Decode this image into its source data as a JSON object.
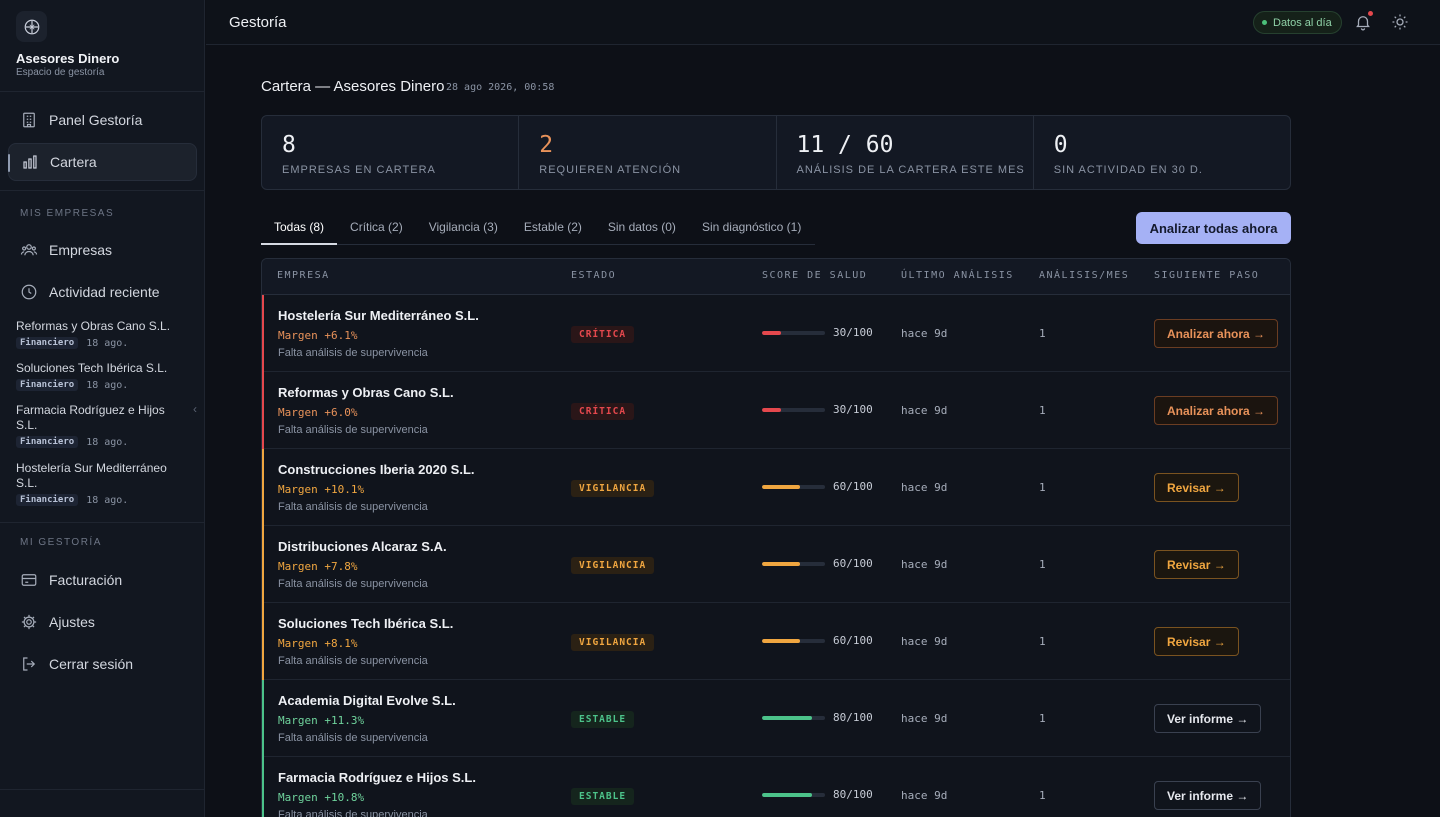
{
  "sidebar": {
    "brand": {
      "name": "Asesores Dinero",
      "subtitle": "Espacio de gestoría"
    },
    "nav_main": [
      {
        "label": "Panel Gestoría",
        "icon": "building-icon",
        "active": false
      },
      {
        "label": "Cartera",
        "icon": "bar-chart-icon",
        "active": true
      }
    ],
    "section_companies": "MIS EMPRESAS",
    "nav_companies": [
      {
        "label": "Empresas",
        "icon": "users-icon"
      },
      {
        "label": "Actividad reciente",
        "icon": "clock-icon"
      }
    ],
    "recent": [
      {
        "name": "Reformas y Obras Cano S.L.",
        "tag": "Financiero",
        "date": "18 ago."
      },
      {
        "name": "Soluciones Tech Ibérica S.L.",
        "tag": "Financiero",
        "date": "18 ago."
      },
      {
        "name": "Farmacia Rodríguez e Hijos S.L.",
        "tag": "Financiero",
        "date": "18 ago."
      },
      {
        "name": "Hostelería Sur Mediterráneo S.L.",
        "tag": "Financiero",
        "date": "18 ago."
      }
    ],
    "section_gestoria": "MI GESTORÍA",
    "nav_gestoria": [
      {
        "label": "Facturación",
        "icon": "credit-card-icon"
      },
      {
        "label": "Ajustes",
        "icon": "gear-icon"
      },
      {
        "label": "Cerrar sesión",
        "icon": "logout-icon"
      }
    ]
  },
  "topbar": {
    "title": "Gestoría",
    "status": "Datos al día"
  },
  "main": {
    "heading": "Cartera — Asesores Dinero",
    "timestamp": "28 ago 2026, 00:58",
    "stats": [
      {
        "value": "8",
        "label": "EMPRESAS EN CARTERA"
      },
      {
        "value": "2",
        "label": "REQUIEREN ATENCIÓN"
      },
      {
        "value": "11 / 60",
        "label": "ANÁLISIS DE LA CARTERA ESTE MES"
      },
      {
        "value": "0",
        "label": "SIN ACTIVIDAD EN 30 D."
      }
    ],
    "tabs": [
      {
        "label": "Todas (8)",
        "active": true
      },
      {
        "label": "Crítica (2)"
      },
      {
        "label": "Vigilancia (3)"
      },
      {
        "label": "Estable (2)"
      },
      {
        "label": "Sin datos (0)"
      },
      {
        "label": "Sin diagnóstico (1)"
      }
    ],
    "primary_action": "Analizar todas ahora",
    "columns": [
      "EMPRESA",
      "ESTADO",
      "SCORE DE SALUD",
      "ÚLTIMO ANÁLISIS",
      "ANÁLISIS/MES",
      "SIGUIENTE PASO"
    ],
    "colors": {
      "critical": "#e5484d",
      "watch": "#f0a640",
      "stable": "#4cc38a"
    },
    "rows": [
      {
        "name": "Hostelería Sur Mediterráneo S.L.",
        "margin": "Margen +6.1%",
        "note": "Falta análisis de supervivencia",
        "status": "CRÍTICA",
        "level": "critical",
        "score": 30,
        "score_text": "30/100",
        "last": "hace 9d",
        "count": "1",
        "action": "Analizar ahora →"
      },
      {
        "name": "Reformas y Obras Cano S.L.",
        "margin": "Margen +6.0%",
        "note": "Falta análisis de supervivencia",
        "status": "CRÍTICA",
        "level": "critical",
        "score": 30,
        "score_text": "30/100",
        "last": "hace 9d",
        "count": "1",
        "action": "Analizar ahora →"
      },
      {
        "name": "Construcciones Iberia 2020 S.L.",
        "margin": "Margen +10.1%",
        "note": "Falta análisis de supervivencia",
        "status": "VIGILANCIA",
        "level": "watch",
        "score": 60,
        "score_text": "60/100",
        "last": "hace 9d",
        "count": "1",
        "action": "Revisar →"
      },
      {
        "name": "Distribuciones Alcaraz S.A.",
        "margin": "Margen +7.8%",
        "note": "Falta análisis de supervivencia",
        "status": "VIGILANCIA",
        "level": "watch",
        "score": 60,
        "score_text": "60/100",
        "last": "hace 9d",
        "count": "1",
        "action": "Revisar →"
      },
      {
        "name": "Soluciones Tech Ibérica S.L.",
        "margin": "Margen +8.1%",
        "note": "Falta análisis de supervivencia",
        "status": "VIGILANCIA",
        "level": "watch",
        "score": 60,
        "score_text": "60/100",
        "last": "hace 9d",
        "count": "1",
        "action": "Revisar →"
      },
      {
        "name": "Academia Digital Evolve S.L.",
        "margin": "Margen +11.3%",
        "note": "Falta análisis de supervivencia",
        "status": "ESTABLE",
        "level": "stable",
        "score": 80,
        "score_text": "80/100",
        "last": "hace 9d",
        "count": "1",
        "action": "Ver informe →"
      },
      {
        "name": "Farmacia Rodríguez e Hijos S.L.",
        "margin": "Margen +10.8%",
        "note": "Falta análisis de supervivencia",
        "status": "ESTABLE",
        "level": "stable",
        "score": 80,
        "score_text": "80/100",
        "last": "hace 9d",
        "count": "1",
        "action": "Ver informe →"
      }
    ]
  }
}
